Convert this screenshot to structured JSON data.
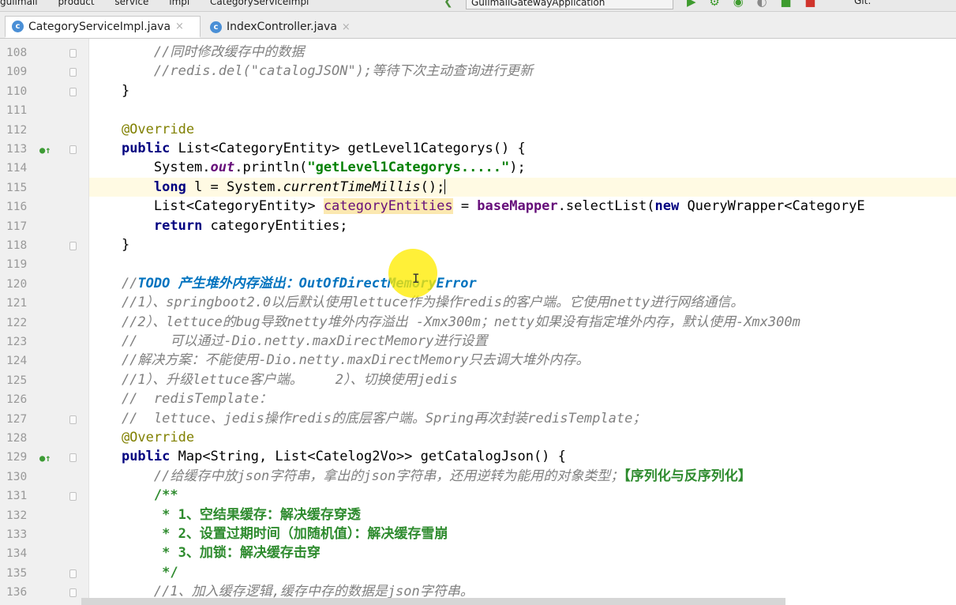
{
  "toolbar": {
    "breadcrumbs": [
      "gulimall",
      "product",
      "service",
      "impl",
      "CategoryServiceImpl"
    ],
    "run_config": "GulimallGatewayApplication",
    "git_label": "Git:"
  },
  "tabs": [
    {
      "label": "CategoryServiceImpl.java",
      "active": true
    },
    {
      "label": "IndexController.java",
      "active": false
    }
  ],
  "editor": {
    "current_line": "115",
    "lines": [
      {
        "num": "108",
        "override": false,
        "fold": true,
        "segments": [
          {
            "text": "        //同时修改缓存中的数据",
            "style": "cm"
          }
        ]
      },
      {
        "num": "109",
        "override": false,
        "fold": true,
        "segments": [
          {
            "text": "        //redis.del(\"catalogJSON\");等待下次主动查询进行更新",
            "style": "cm"
          }
        ]
      },
      {
        "num": "110",
        "override": false,
        "fold": true,
        "segments": [
          {
            "text": "    }",
            "style": ""
          }
        ]
      },
      {
        "num": "111",
        "override": false,
        "fold": false,
        "segments": []
      },
      {
        "num": "112",
        "override": false,
        "fold": false,
        "segments": [
          {
            "text": "    @Override",
            "style": "ann"
          }
        ]
      },
      {
        "num": "113",
        "override": true,
        "fold": true,
        "segments": [
          {
            "text": "    ",
            "style": ""
          },
          {
            "text": "public",
            "style": "kw"
          },
          {
            "text": " List<CategoryEntity> getLevel1Categorys() {",
            "style": ""
          }
        ]
      },
      {
        "num": "114",
        "override": false,
        "fold": false,
        "segments": [
          {
            "text": "        System.",
            "style": ""
          },
          {
            "text": "out",
            "style": "sf"
          },
          {
            "text": ".println(",
            "style": ""
          },
          {
            "text": "\"getLevel1Categorys.....\"",
            "style": "str"
          },
          {
            "text": ");",
            "style": ""
          }
        ]
      },
      {
        "num": "115",
        "override": false,
        "fold": false,
        "segments": [
          {
            "text": "        ",
            "style": ""
          },
          {
            "text": "long",
            "style": "kw"
          },
          {
            "text": " l = System.",
            "style": ""
          },
          {
            "text": "currentTimeMillis",
            "style": "sm"
          },
          {
            "text": "();",
            "style": ""
          },
          {
            "text": "",
            "style": "caret"
          }
        ]
      },
      {
        "num": "116",
        "override": false,
        "fold": false,
        "segments": [
          {
            "text": "        List<CategoryEntity> ",
            "style": ""
          },
          {
            "text": "categoryEntities",
            "style": "hlv"
          },
          {
            "text": " = ",
            "style": ""
          },
          {
            "text": "baseMapper",
            "style": "fld"
          },
          {
            "text": ".selectList(",
            "style": ""
          },
          {
            "text": "new",
            "style": "kw"
          },
          {
            "text": " QueryWrapper<CategoryE",
            "style": ""
          }
        ]
      },
      {
        "num": "117",
        "override": false,
        "fold": false,
        "segments": [
          {
            "text": "        ",
            "style": ""
          },
          {
            "text": "return",
            "style": "kw"
          },
          {
            "text": " categoryEntities;",
            "style": ""
          }
        ]
      },
      {
        "num": "118",
        "override": false,
        "fold": true,
        "segments": [
          {
            "text": "    }",
            "style": ""
          }
        ]
      },
      {
        "num": "119",
        "override": false,
        "fold": false,
        "segments": []
      },
      {
        "num": "120",
        "override": false,
        "fold": false,
        "segments": [
          {
            "text": "    //",
            "style": "cm"
          },
          {
            "text": "TODO 产生堆外内存溢出：OutOfDirectMemoryError",
            "style": "todo"
          }
        ]
      },
      {
        "num": "121",
        "override": false,
        "fold": false,
        "segments": [
          {
            "text": "    //1）、springboot2.0以后默认使用lettuce作为操作redis的客户端。它使用netty进行网络通信。",
            "style": "cm"
          }
        ]
      },
      {
        "num": "122",
        "override": false,
        "fold": false,
        "segments": [
          {
            "text": "    //2）、lettuce的bug导致netty堆外内存溢出 -Xmx300m；netty如果没有指定堆外内存，默认使用-Xmx300m",
            "style": "cm"
          }
        ]
      },
      {
        "num": "123",
        "override": false,
        "fold": false,
        "segments": [
          {
            "text": "    //    可以通过-Dio.netty.maxDirectMemory进行设置",
            "style": "cm"
          }
        ]
      },
      {
        "num": "124",
        "override": false,
        "fold": false,
        "segments": [
          {
            "text": "    //解决方案：不能使用-Dio.netty.maxDirectMemory只去调大堆外内存。",
            "style": "cm"
          }
        ]
      },
      {
        "num": "125",
        "override": false,
        "fold": false,
        "segments": [
          {
            "text": "    //1）、升级lettuce客户端。    2）、切换使用jedis",
            "style": "cm"
          }
        ]
      },
      {
        "num": "126",
        "override": false,
        "fold": false,
        "segments": [
          {
            "text": "    //  redisTemplate：",
            "style": "cm"
          }
        ]
      },
      {
        "num": "127",
        "override": false,
        "fold": true,
        "segments": [
          {
            "text": "    //  lettuce、jedis操作redis的底层客户端。Spring再次封装redisTemplate；",
            "style": "cm"
          }
        ]
      },
      {
        "num": "128",
        "override": false,
        "fold": false,
        "segments": [
          {
            "text": "    @Override",
            "style": "ann"
          }
        ]
      },
      {
        "num": "129",
        "override": true,
        "fold": true,
        "segments": [
          {
            "text": "    ",
            "style": ""
          },
          {
            "text": "public",
            "style": "kw"
          },
          {
            "text": " Map<String, List<Catelog2Vo>> getCatalogJson() {",
            "style": ""
          }
        ]
      },
      {
        "num": "130",
        "override": false,
        "fold": false,
        "segments": [
          {
            "text": "        //给缓存中放json字符串，拿出的json字符串，还用逆转为能用的对象类型；",
            "style": "cm"
          },
          {
            "text": "【序列化与反序列化】",
            "style": "doc"
          }
        ]
      },
      {
        "num": "131",
        "override": false,
        "fold": true,
        "segments": [
          {
            "text": "        /**",
            "style": "doc"
          }
        ]
      },
      {
        "num": "132",
        "override": false,
        "fold": false,
        "segments": [
          {
            "text": "         * 1、空结果缓存：解决缓存穿透",
            "style": "doc"
          }
        ]
      },
      {
        "num": "133",
        "override": false,
        "fold": false,
        "segments": [
          {
            "text": "         * 2、设置过期时间（加随机值）：解决缓存雪崩",
            "style": "doc"
          }
        ]
      },
      {
        "num": "134",
        "override": false,
        "fold": false,
        "segments": [
          {
            "text": "         * 3、加锁：解决缓存击穿",
            "style": "doc"
          }
        ]
      },
      {
        "num": "135",
        "override": false,
        "fold": true,
        "segments": [
          {
            "text": "         */",
            "style": "doc"
          }
        ]
      },
      {
        "num": "136",
        "override": false,
        "fold": true,
        "segments": [
          {
            "text": "        //1、加入缓存逻辑,缓存中存的数据是json字符串。",
            "style": "cm"
          }
        ]
      }
    ]
  }
}
